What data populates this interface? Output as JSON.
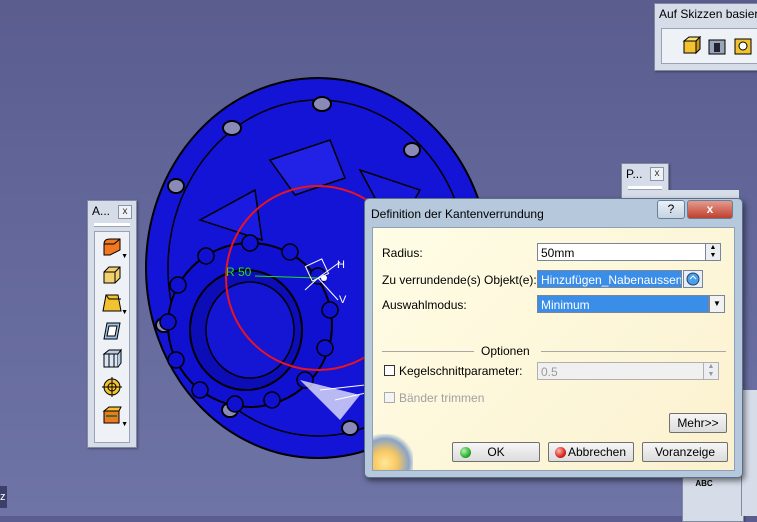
{
  "toolbars": {
    "sketch_based": {
      "title": "Auf Skizzen basier"
    },
    "small_p": {
      "title": "P..."
    },
    "annotations": {
      "title": "A..."
    }
  },
  "viewport": {
    "radius_annotation": "R 50",
    "axis_h": "H",
    "axis_v": "V",
    "compass_z": "z",
    "bottom_right_label": "ABC"
  },
  "dialog": {
    "title": "Definition der Kantenverrundung",
    "help_label": "?",
    "close_label": "x",
    "radius_label": "Radius:",
    "radius_value": "50mm",
    "objects_label": "Zu verrundende(s) Objekt(e):",
    "objects_value": "Hinzufügen_Nabenaussen",
    "selection_mode_label": "Auswahlmodus:",
    "selection_mode_value": "Minimum",
    "options_header": "Optionen",
    "conic_label": "Kegelschnittparameter:",
    "conic_value": "0.5",
    "trim_ribbons_label": "Bänder trimmen",
    "more_button": "Mehr>>",
    "ok_button": "OK",
    "cancel_button": "Abbrechen",
    "preview_button": "Voranzeige"
  },
  "colors": {
    "model_blue": "#1212d8",
    "fillet_circle": "#e8141e",
    "dialog_frame": "#b6c8dc",
    "dialog_panel": "#fdf6dc",
    "selection_highlight": "#3a8ee8",
    "ok_icon": "#2fb02f",
    "cancel_icon": "#d8261e"
  }
}
